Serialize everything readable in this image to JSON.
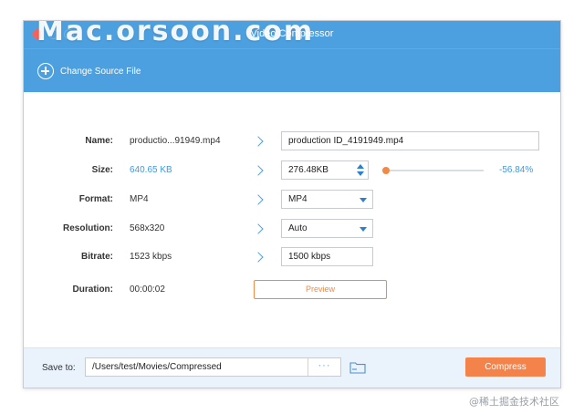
{
  "window": {
    "title": "Video Compressor"
  },
  "watermark": "Mac.orsoon.com",
  "toolbar": {
    "change_source_label": "Change Source File",
    "change_source_icon": "plus-circle-icon"
  },
  "rows": {
    "name": {
      "label": "Name:",
      "original": "productio...91949.mp4",
      "output": "production ID_4191949.mp4"
    },
    "size": {
      "label": "Size:",
      "original": "640.65 KB",
      "output": "276.48KB",
      "slider_fraction": 0.0,
      "percent": "-56.84%"
    },
    "format": {
      "label": "Format:",
      "original": "MP4",
      "output": "MP4"
    },
    "resolution": {
      "label": "Resolution:",
      "original": "568x320",
      "output": "Auto"
    },
    "bitrate": {
      "label": "Bitrate:",
      "original": "1523 kbps",
      "output": "1500 kbps"
    },
    "duration": {
      "label": "Duration:",
      "original": "00:00:02"
    }
  },
  "preview_label": "Preview",
  "footer": {
    "save_to_label": "Save to:",
    "path": "/Users/test/Movies/Compressed",
    "browse_label": "···",
    "compress_label": "Compress"
  },
  "credit": "@稀土掘金技术社区",
  "colors": {
    "accent": "#4da0df",
    "orange": "#f3834a",
    "value_blue": "#3d9be0"
  }
}
